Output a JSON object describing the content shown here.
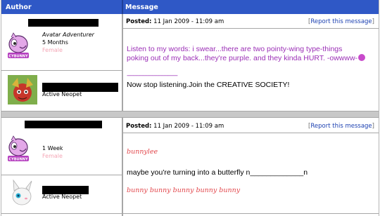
{
  "header": {
    "author": "Author",
    "message": "Message"
  },
  "posts": [
    {
      "posted_label": "Posted:",
      "posted_date": "11 Jan 2009 - 11:09 am",
      "report": {
        "open": "[",
        "link": "Report this message",
        "close": "]"
      },
      "user": {
        "title": "Avatar Adventurer",
        "age": "5 Months",
        "gender": "Female",
        "avatar_label": "CYBUNNY"
      },
      "pet_label": "Active Neopet",
      "message": {
        "line1": "Listen to my words: i swear...there are two pointy-wing type-things",
        "line2": "poking out of my back...they're purple. and they kinda HURT. -owwww-",
        "dashes": "--------------------------------",
        "line3": "Now stop listening.Join the CREATIVE SOCIETY!"
      }
    },
    {
      "posted_label": "Posted:",
      "posted_date": "11 Jan 2009 - 11:09 am",
      "report": {
        "open": "[",
        "link": "Report this message",
        "close": "]"
      },
      "user": {
        "age": "1 Week",
        "gender": "Female",
        "avatar_label": "CYBUNNY"
      },
      "pet_label": "Active Neopet",
      "message": {
        "sig_top": "bunnylee",
        "line1": "maybe you're turning into a butterfly n_____________n",
        "sig_bottom": "bunny bunny bunny bunny bunny"
      }
    }
  ],
  "colors": {
    "header_bg": "#2f58c6",
    "purple_text": "#9b2fb6",
    "female": "#f4a6b6",
    "signature": "#e2464b"
  }
}
